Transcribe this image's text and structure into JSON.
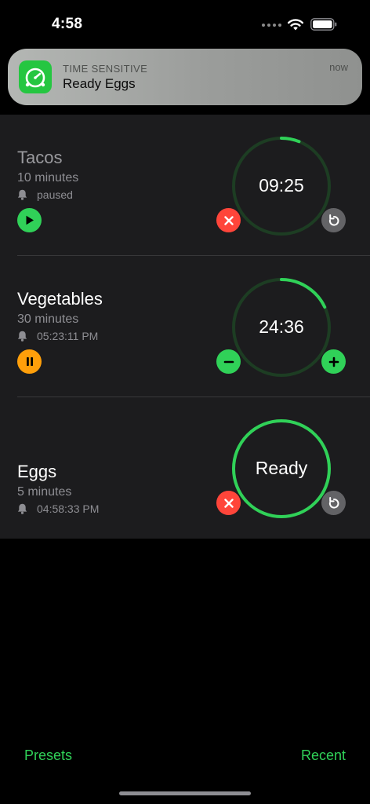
{
  "status_bar": {
    "time": "4:58"
  },
  "notification": {
    "category": "TIME SENSITIVE",
    "title": "Ready Eggs",
    "time": "now",
    "app_icon": "stopwatch-icon"
  },
  "timers": [
    {
      "name": "Tacos",
      "duration": "10 minutes",
      "alarm": "paused",
      "display": "09:25",
      "state": "paused",
      "progress": 0.06,
      "left_action": "cancel",
      "right_action": "reset",
      "state_button": "play"
    },
    {
      "name": "Vegetables",
      "duration": "30 minutes",
      "alarm": "05:23:11 PM",
      "display": "24:36",
      "state": "running",
      "progress": 0.18,
      "left_action": "subtract-minute",
      "right_action": "add-minute",
      "state_button": "pause"
    },
    {
      "name": "Eggs",
      "duration": "5 minutes",
      "alarm": "04:58:33 PM",
      "display": "Ready",
      "state": "finished",
      "progress": 1.0,
      "left_action": "cancel",
      "right_action": "reset"
    }
  ],
  "toolbar": {
    "presets_label": "Presets",
    "recent_label": "Recent"
  },
  "colors": {
    "accent_green": "#30d158",
    "ring_track": "#1d3d23",
    "cancel_red": "#ff453a",
    "pause_orange": "#ff9f0a",
    "reset_gray": "#636366",
    "panel": "#1c1c1e"
  }
}
